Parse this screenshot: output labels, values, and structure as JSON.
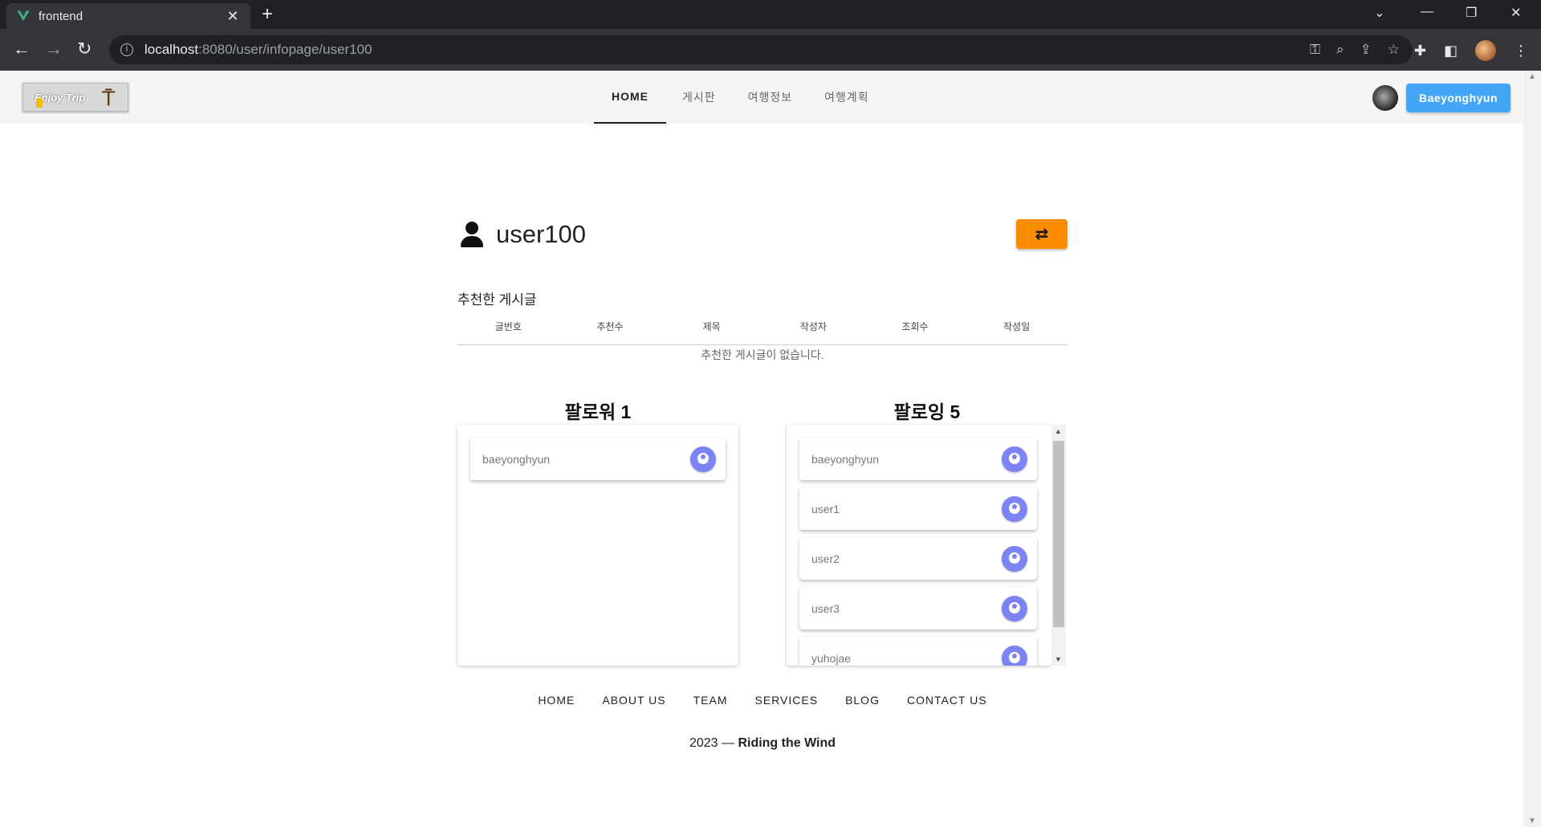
{
  "browser": {
    "tab_title": "frontend",
    "url_host": "localhost",
    "url_path": ":8080/user/infopage/user100"
  },
  "header": {
    "logo_text": "Enjoy Trip",
    "nav": [
      {
        "label": "HOME",
        "active": true
      },
      {
        "label": "게시판",
        "active": false
      },
      {
        "label": "여행정보",
        "active": false
      },
      {
        "label": "여행계획",
        "active": false
      }
    ],
    "user_button": "Baeyonghyun"
  },
  "profile": {
    "username": "user100"
  },
  "recommended": {
    "title": "추천한 게시글",
    "columns": [
      "글번호",
      "추천수",
      "제목",
      "작성자",
      "조회수",
      "작성일"
    ],
    "empty_message": "추천한 게시글이 없습니다."
  },
  "followers": {
    "title": "팔로워 1",
    "items": [
      "baeyonghyun"
    ]
  },
  "following": {
    "title": "팔로잉 5",
    "items": [
      "baeyonghyun",
      "user1",
      "user2",
      "user3",
      "yuhojae"
    ]
  },
  "footer": {
    "links": [
      "HOME",
      "ABOUT US",
      "TEAM",
      "SERVICES",
      "BLOG",
      "CONTACT US"
    ],
    "year": "2023 —",
    "brand": "Riding the Wind"
  },
  "colors": {
    "accent_blue": "#42a5f5",
    "swap_orange": "#fb8c00",
    "avatar_purple": "#7c83f5"
  }
}
